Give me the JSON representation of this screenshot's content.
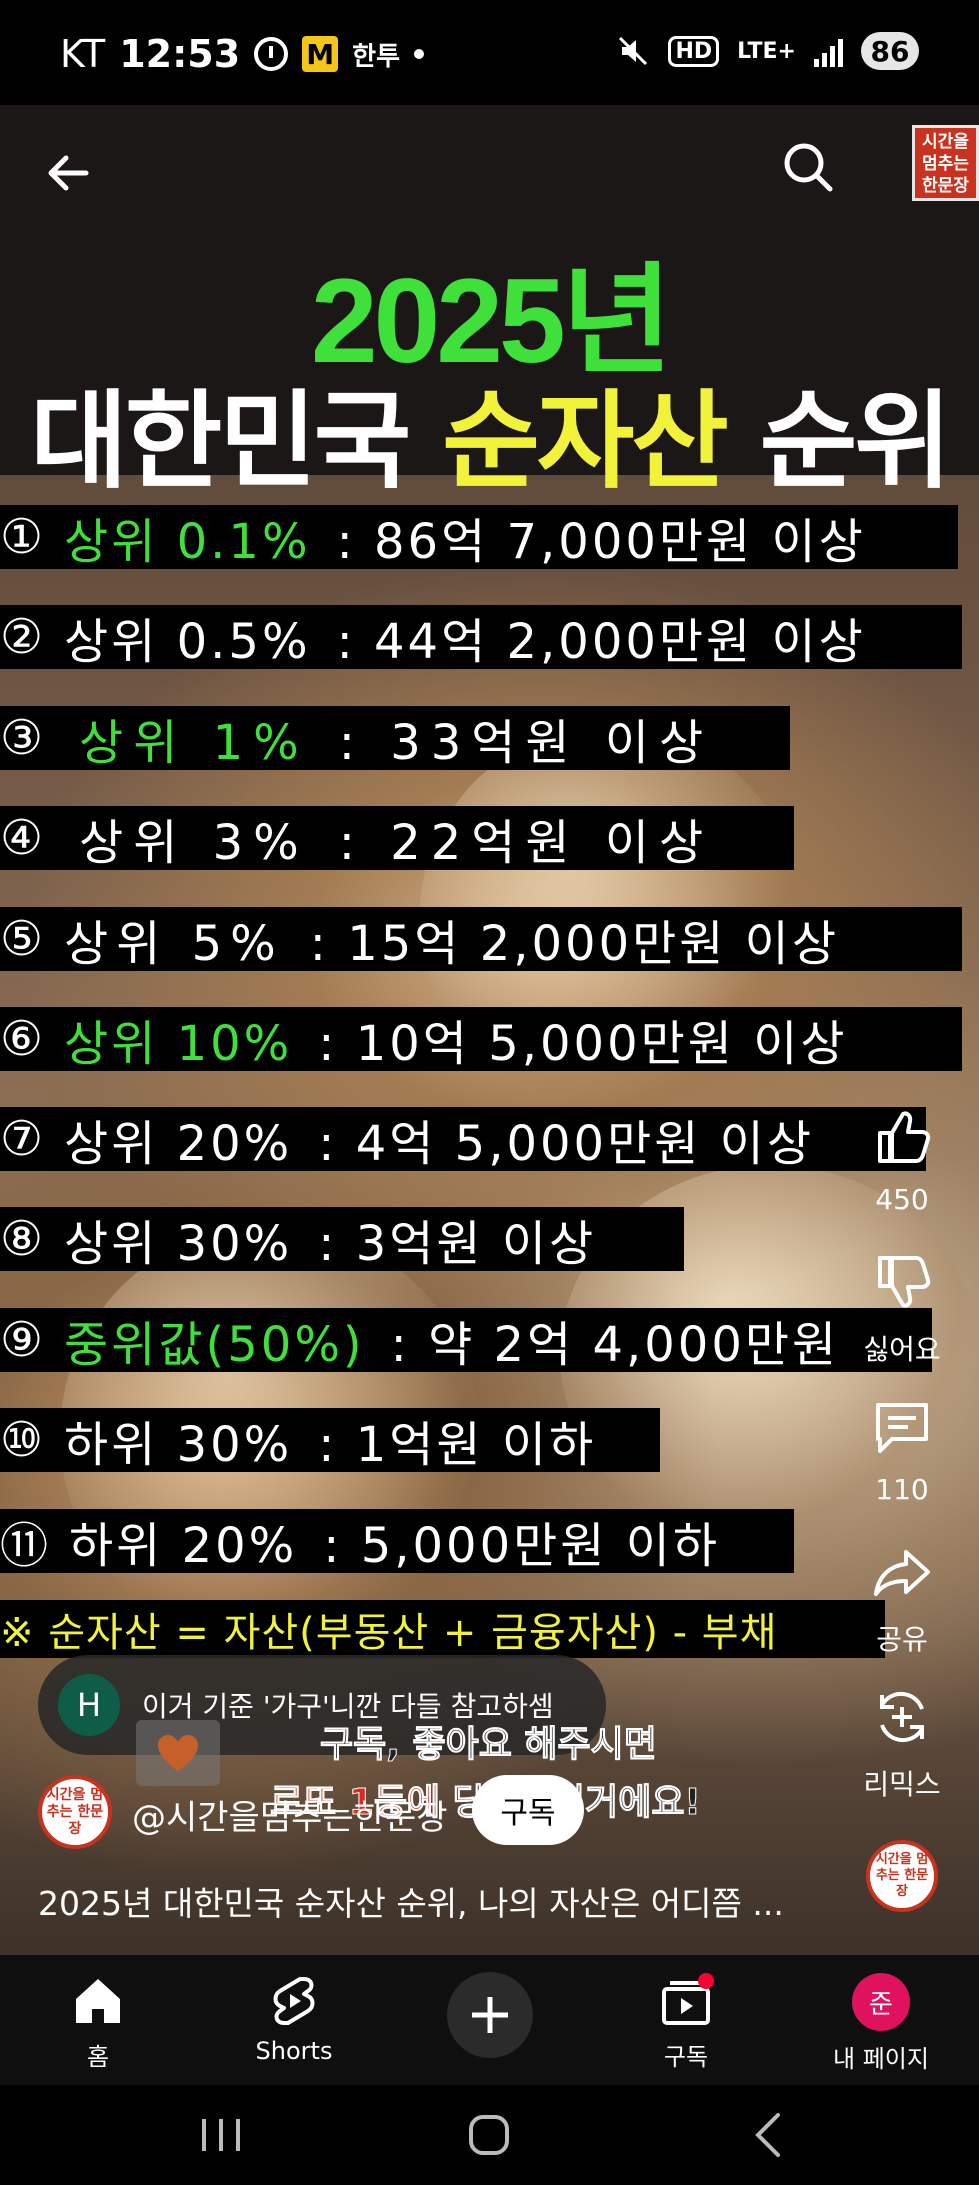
{
  "status_bar": {
    "carrier": "KT",
    "time": "12:53",
    "app_badge": "M",
    "app_label": "한투",
    "hd": "HD",
    "network": "LTE+",
    "battery": "86"
  },
  "channel_badge_text": "시간을 멈추는 한문장",
  "video": {
    "title_year": "2025년",
    "title_main_pre": "대한민국 ",
    "title_main_highlight": "순자산",
    "title_main_post": " 순위",
    "ranks": [
      {
        "num": "①",
        "label": "상위 0.1%",
        "value": ": 86억 7,000만원 이상",
        "highlight": true
      },
      {
        "num": "②",
        "label": "상위 0.5%",
        "value": ": 44억 2,000만원 이상",
        "highlight": false
      },
      {
        "num": "③",
        "label": "상위 1%",
        "value": ": 33억원 이상",
        "highlight": true
      },
      {
        "num": "④",
        "label": "상위 3%",
        "value": ": 22억원 이상",
        "highlight": false
      },
      {
        "num": "⑤",
        "label": "상위 5%",
        "value": ": 15억 2,000만원 이상",
        "highlight": false
      },
      {
        "num": "⑥",
        "label": "상위 10%",
        "value": ": 10억 5,000만원 이상",
        "highlight": true
      },
      {
        "num": "⑦",
        "label": "상위 20%",
        "value": ": 4억 5,000만원 이상",
        "highlight": false
      },
      {
        "num": "⑧",
        "label": "상위 30%",
        "value": ": 3억원 이상",
        "highlight": false
      },
      {
        "num": "⑨",
        "label": "중위값(50%)",
        "value": ": 약 2억 4,000만원",
        "highlight": true
      },
      {
        "num": "⑩",
        "label": "하위 30%",
        "value": ": 1억원 이하",
        "highlight": false
      },
      {
        "num": "⑪",
        "label": "하위 20%",
        "value": ": 5,000만원 이하",
        "highlight": false
      }
    ],
    "note": "※ 순자산 = 자산(부동산 + 금융자산) - 부채",
    "pinned_comment": {
      "avatar_letter": "H",
      "text": "이거 기준 '가구'니깐 다들 참고하셈"
    },
    "promo_line1": "구독, 좋아요 해주시면",
    "promo_line2_red": "로또 1등에",
    "promo_line2_rest": " 당첨되실거에요!",
    "channel_avatar_text": "시간을 멈추는 한문장",
    "channel_name": "@시간을멈추는한문장",
    "subscribe_label": "구독",
    "video_title": "2025년 대한민국 순자산 순위, 나의 자산은 어디쯤 ..."
  },
  "actions": {
    "like_count": "450",
    "dislike_label": "싫어요",
    "comment_count": "110",
    "share_label": "공유",
    "remix_label": "리믹스"
  },
  "bottom_nav": {
    "home": "홈",
    "shorts": "Shorts",
    "subscriptions": "구독",
    "me": "내 페이지",
    "me_avatar": "준"
  },
  "colors": {
    "green_highlight": "#3fe03a",
    "yellow_highlight": "#f2f23a",
    "brand_red": "#c8321e",
    "avatar_pink": "#e0115f"
  }
}
